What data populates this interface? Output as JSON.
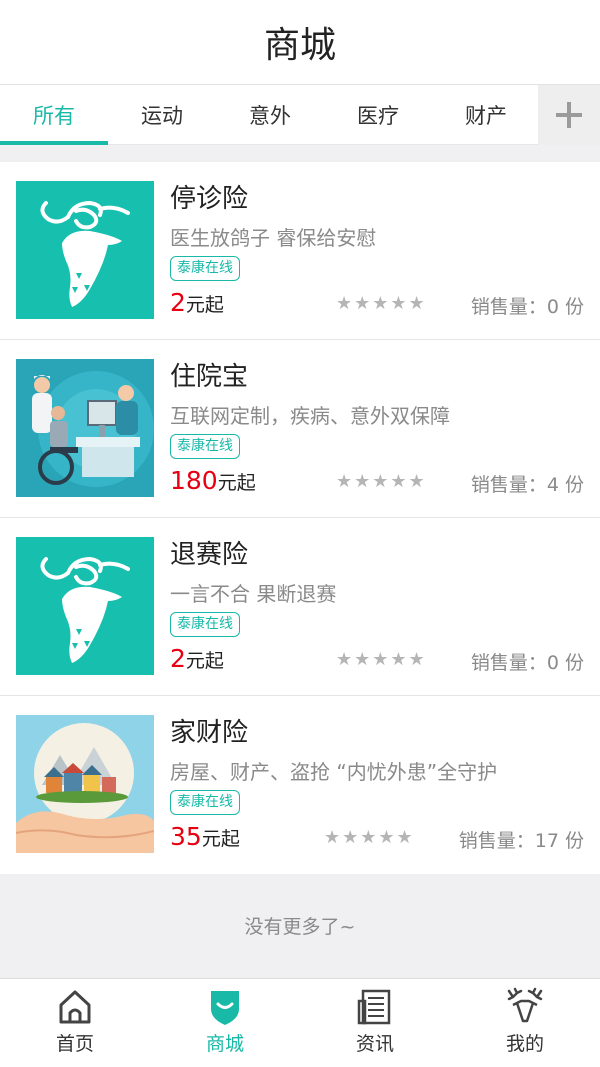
{
  "header": {
    "title": "商城"
  },
  "tabs": [
    {
      "label": "所有",
      "active": true
    },
    {
      "label": "运动",
      "active": false
    },
    {
      "label": "意外",
      "active": false
    },
    {
      "label": "医疗",
      "active": false
    },
    {
      "label": "财产",
      "active": false
    }
  ],
  "tab_add_icon": "plus-icon",
  "products": [
    {
      "name": "停诊险",
      "desc": "医生放鸽子 睿保给安慰",
      "badge": "泰康在线",
      "price": "2",
      "price_suffix": "元起",
      "stars": "★★★★★",
      "sales_label": "销售量：",
      "sales_value": "0 份",
      "image": "deer-logo"
    },
    {
      "name": "住院宝",
      "desc": "互联网定制，疾病、意外双保障",
      "badge": "泰康在线",
      "price": "180",
      "price_suffix": "元起",
      "stars": "★★★★★",
      "sales_label": "销售量：",
      "sales_value": "4 份",
      "image": "hospital-illustration"
    },
    {
      "name": "退赛险",
      "desc": "一言不合 果断退赛",
      "badge": "泰康在线",
      "price": "2",
      "price_suffix": "元起",
      "stars": "★★★★★",
      "sales_label": "销售量：",
      "sales_value": "0 份",
      "image": "deer-logo"
    },
    {
      "name": "家财险",
      "desc": "房屋、财产、盗抢 “内忧外患”全守护",
      "badge": "泰康在线",
      "price": "35",
      "price_suffix": "元起",
      "stars": "★★★★★",
      "sales_label": "销售量：",
      "sales_value": "17 份",
      "image": "house-in-hand-illustration"
    }
  ],
  "no_more": "没有更多了~",
  "bottom_nav": [
    {
      "label": "首页",
      "icon": "home-icon",
      "active": false
    },
    {
      "label": "商城",
      "icon": "shield-icon",
      "active": true
    },
    {
      "label": "资讯",
      "icon": "news-icon",
      "active": false
    },
    {
      "label": "我的",
      "icon": "deer-icon",
      "active": false
    }
  ],
  "colors": {
    "accent": "#19b9a8",
    "price": "#e60012"
  }
}
